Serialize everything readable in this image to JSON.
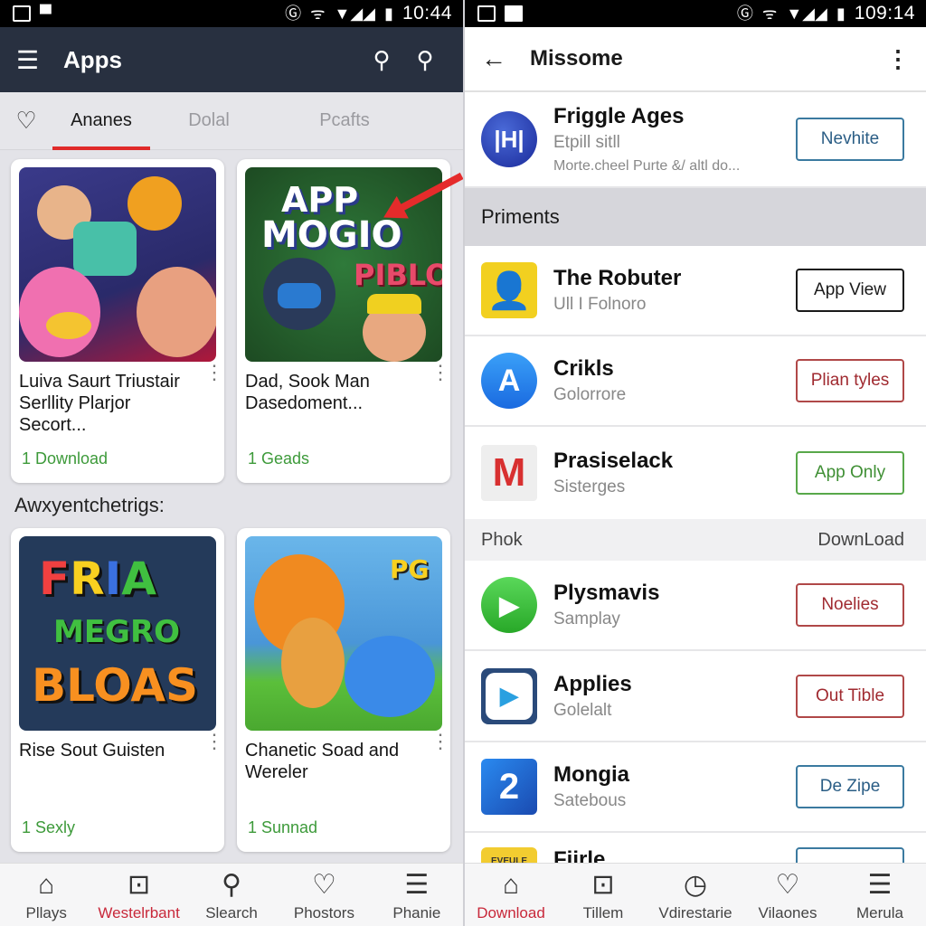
{
  "left": {
    "status": {
      "time": "10:44"
    },
    "appbar": {
      "title": "Apps",
      "menu_icon": "menu-icon",
      "search_icon": "search-icon",
      "search2_icon": "search-icon"
    },
    "tabs": [
      {
        "label": "Ananes",
        "active": true
      },
      {
        "label": "Dolal"
      },
      {
        "label": "Pcafts"
      }
    ],
    "cards_top": [
      {
        "title": "Luiva Saurt Triustair Serllity Plarjor Secort...",
        "meta": "1 Download"
      },
      {
        "title": "Dad, Sook Man Dasedoment...",
        "meta": "1 Geads",
        "thumb_text_1": "APP",
        "thumb_text_2": "MOGIO",
        "thumb_text_3": "PIBLO"
      }
    ],
    "section_title": "Awxyentchetrigs:",
    "cards_bottom": [
      {
        "title": "Rise Sout Guisten",
        "meta": "1 Sexly",
        "thumb_text_1": "FRIA",
        "thumb_text_2": "MEGRO",
        "thumb_text_3": "BLOAS"
      },
      {
        "title": "Chanetic Soad and Wereler",
        "meta": "1 Sunnad",
        "thumb_text_1": "PG"
      }
    ],
    "bottom_nav": [
      {
        "label": "Pllays",
        "icon": "home-icon"
      },
      {
        "label": "Westelrbant",
        "icon": "bag-icon",
        "active": true
      },
      {
        "label": "Slearch",
        "icon": "search-icon"
      },
      {
        "label": "Phostors",
        "icon": "heart-icon"
      },
      {
        "label": "Phanie",
        "icon": "menu-icon"
      }
    ]
  },
  "right": {
    "status": {
      "time": "109:14"
    },
    "appbar": {
      "title": "Missome",
      "back_icon": "back-arrow-icon",
      "more_icon": "more-vert-icon"
    },
    "top_item": {
      "name": "Friggle Ages",
      "sub": "Etpill sitll",
      "desc": "Morte.cheel Purte &/ altl do...",
      "button": "Nevhite"
    },
    "section1": "Priments",
    "items1": [
      {
        "name": "The Robuter",
        "sub": "Ull I Folnoro",
        "button": "App View"
      },
      {
        "name": "Crikls",
        "sub": "Golorrore",
        "button": "Plian tyles"
      },
      {
        "name": "Prasiselack",
        "sub": "Sisterges",
        "button": "App Only"
      }
    ],
    "section2": {
      "left": "Phok",
      "right": "DownLoad"
    },
    "items2": [
      {
        "name": "Plysmavis",
        "sub": "Samplay",
        "button": "Noelies"
      },
      {
        "name": "Applies",
        "sub": "Golelalt",
        "button": "Out Tible"
      },
      {
        "name": "Mongia",
        "sub": "Satebous",
        "button": "De Zipe",
        "icon_text": "2"
      },
      {
        "name": "Fiirle",
        "icon_text": "EVEULE"
      }
    ],
    "bottom_nav": [
      {
        "label": "Download",
        "icon": "store-icon",
        "active": true
      },
      {
        "label": "Tillem",
        "icon": "bag-icon"
      },
      {
        "label": "Vdirestarie",
        "icon": "clock-icon"
      },
      {
        "label": "Vilaones",
        "icon": "heart-icon"
      },
      {
        "label": "Merula",
        "icon": "menu-icon"
      }
    ]
  },
  "colors": {
    "accent_red": "#e02a2a",
    "dark_appbar": "#283040",
    "green_meta": "#3d9a3a"
  }
}
